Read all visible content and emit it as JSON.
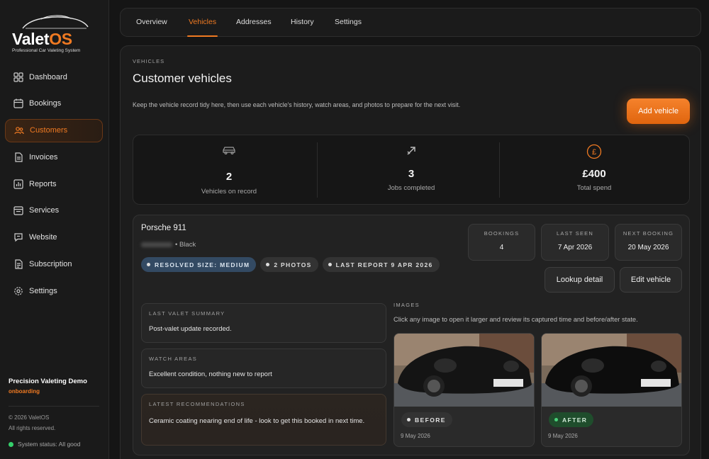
{
  "brand": {
    "name_main": "Valet",
    "name_accent": "OS",
    "tagline": "Professional Car Valeting System",
    "accent_color": "#f07a22"
  },
  "sidebar": {
    "items": [
      {
        "label": "Dashboard",
        "icon": "dashboard-icon",
        "active": false
      },
      {
        "label": "Bookings",
        "icon": "calendar-icon",
        "active": false
      },
      {
        "label": "Customers",
        "icon": "customers-icon",
        "active": true
      },
      {
        "label": "Invoices",
        "icon": "invoice-icon",
        "active": false
      },
      {
        "label": "Reports",
        "icon": "reports-icon",
        "active": false
      },
      {
        "label": "Services",
        "icon": "services-icon",
        "active": false
      },
      {
        "label": "Website",
        "icon": "website-icon",
        "active": false
      },
      {
        "label": "Subscription",
        "icon": "subscription-icon",
        "active": false
      },
      {
        "label": "Settings",
        "icon": "gear-icon",
        "active": false
      }
    ],
    "org_name": "Precision Valeting Demo",
    "org_status": "onboarding",
    "copyright": "© 2026 ValetOS",
    "rights": "All rights reserved.",
    "system_status": "System status: All good"
  },
  "tabs": [
    {
      "label": "Overview",
      "active": false
    },
    {
      "label": "Vehicles",
      "active": true
    },
    {
      "label": "Addresses",
      "active": false
    },
    {
      "label": "History",
      "active": false
    },
    {
      "label": "Settings",
      "active": false
    }
  ],
  "section": {
    "eyebrow": "VEHICLES",
    "title": "Customer vehicles",
    "description": "Keep the vehicle record tidy here, then use each vehicle's history, watch areas, and photos to prepare for the next visit.",
    "add_button": "Add vehicle"
  },
  "stats": [
    {
      "value": "2",
      "label": "Vehicles on record",
      "icon": "car-icon"
    },
    {
      "value": "3",
      "label": "Jobs completed",
      "icon": "trend-arrow-icon"
    },
    {
      "value": "£400",
      "label": "Total spend",
      "icon": "pound-icon"
    }
  ],
  "vehicle": {
    "name": "Porsche 911",
    "colour": "• Black",
    "pills": [
      "RESOLVED SIZE: MEDIUM",
      "2 PHOTOS",
      "LAST REPORT 9 APR 2026"
    ],
    "bookings_label": "BOOKINGS",
    "bookings_value": "4",
    "last_seen_label": "LAST SEEN",
    "last_seen_value": "7 Apr 2026",
    "next_booking_label": "NEXT BOOKING",
    "next_booking_value": "20 May 2026",
    "lookup_button": "Lookup detail",
    "edit_button": "Edit vehicle",
    "last_valet_label": "LAST VALET SUMMARY",
    "last_valet_value": "Post-valet update recorded.",
    "watch_label": "WATCH AREAS",
    "watch_value": "Excellent condition, nothing new to report",
    "recs_label": "LATEST RECOMMENDATIONS",
    "recs_value": "Ceramic coating nearing end of life - look to get this booked in next time.",
    "images_label": "IMAGES",
    "images_help": "Click any image to open it larger and review its captured time and before/after state.",
    "photos": [
      {
        "state": "BEFORE",
        "date": "9 May 2026",
        "badge_bg": "#333333",
        "dot": "#dddddd"
      },
      {
        "state": "AFTER",
        "date": "9 May 2026",
        "badge_bg": "#1f4d2c",
        "dot": "#4ad17a"
      }
    ]
  }
}
